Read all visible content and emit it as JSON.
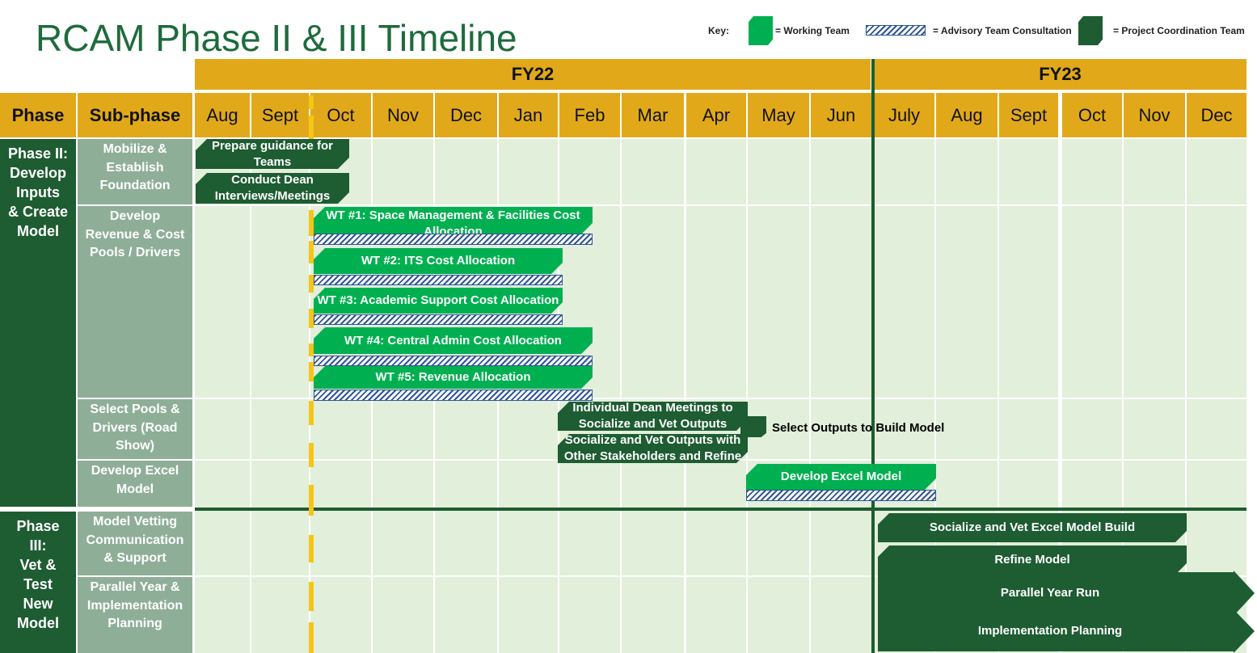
{
  "title": "RCAM Phase II & III Timeline",
  "key": {
    "label": "Key:",
    "working_team": "= Working Team",
    "advisory": "= Advisory Team Consultation",
    "project_coordination": "= Project Coordination Team"
  },
  "fiscal_years": [
    "FY22",
    "FY23"
  ],
  "headers": {
    "phase": "Phase",
    "sub_phase": "Sub-phase",
    "months": [
      "Aug",
      "Sept",
      "Oct",
      "Nov",
      "Dec",
      "Jan",
      "Feb",
      "Mar",
      "Apr",
      "May",
      "Jun",
      "July",
      "Aug",
      "Sept",
      "Oct",
      "Nov",
      "Dec"
    ]
  },
  "phases": [
    {
      "label": "Phase II:\nDevelop\nInputs\n& Create\nModel"
    },
    {
      "label": "Phase\nIII:\nVet &\nTest\nNew\nModel"
    }
  ],
  "subphases": [
    "Mobilize &\nEstablish\nFoundation",
    "Develop\nRevenue & Cost\nPools / Drivers",
    "Select Pools &\nDrivers (Road\nShow)",
    "Develop Excel\nModel",
    "Model Vetting\nCommunication\n& Support",
    "Parallel Year &\nImplementation\nPlanning"
  ],
  "tasks": {
    "prepare_guidance": "Prepare guidance for\nTeams",
    "dean_interviews": "Conduct Dean\nInterviews/Meetings",
    "wt1": "WT #1: Space Management & Facilities Cost\nAllocation",
    "wt2": "WT #2: ITS Cost Allocation",
    "wt3": "WT #3: Academic Support Cost Allocation",
    "wt4": "WT #4: Central Admin Cost Allocation",
    "wt5": "WT #5: Revenue Allocation",
    "dean_meetings": "Individual Dean Meetings to\nSocialize and Vet Outputs",
    "socialize_stakeholders": "Socialize and Vet Outputs with\nOther Stakeholders and Refine",
    "select_outputs": "Select Outputs to Build Model",
    "develop_excel": "Develop Excel Model",
    "socialize_excel": "Socialize and Vet Excel Model Build",
    "refine_model": "Refine Model",
    "parallel_year": "Parallel Year Run",
    "implementation": "Implementation Planning"
  },
  "colors": {
    "dark_green": "#1e5c32",
    "working_team_green": "#00b050",
    "header_gold": "#e1a91a",
    "grid_light": "#e2efda",
    "subphase_gray": "#8fae98",
    "hatch_blue": "#2e5597",
    "today_marker": "#f5c518"
  }
}
